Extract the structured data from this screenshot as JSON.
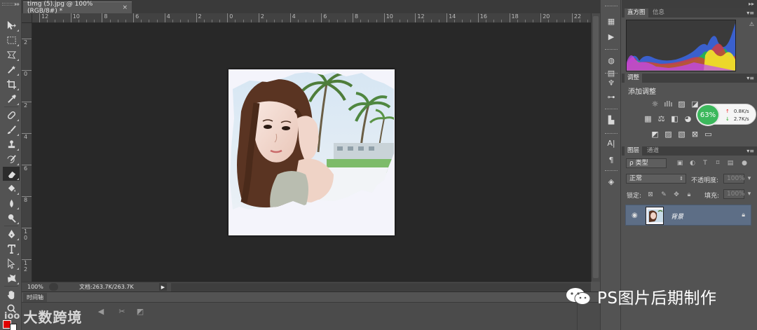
{
  "document": {
    "tab_title": "timg (5).jpg @ 100%(RGB/8#) *",
    "tab_close": "×",
    "zoom": "100%",
    "doc_info": "文档:263.7K/263.7K",
    "horizontal_ruler_marks": [
      "12",
      "10",
      "8",
      "6",
      "4",
      "2",
      "0",
      "2",
      "4",
      "6",
      "8",
      "10",
      "12",
      "14",
      "16",
      "18",
      "20",
      "22"
    ],
    "vertical_ruler_marks": [
      "2",
      "0",
      "2",
      "4",
      "6",
      "8",
      "1 0",
      "1 2"
    ]
  },
  "timeline": {
    "tab_label": "时间轴"
  },
  "panels": {
    "histogram_tabs": [
      "直方图",
      "信息"
    ],
    "adjustments_tab": "调整",
    "adjustments_title": "添加调整",
    "layers_tabs": [
      "图层",
      "通道"
    ],
    "filter_kind": "ρ 类型",
    "blend_mode": "正常",
    "opacity_label": "不透明度:",
    "opacity_value": "100%",
    "lock_label": "锁定:",
    "fill_label": "填充:",
    "fill_value": "100%",
    "layer_name": "背景"
  },
  "network_widget": {
    "percent": "63%",
    "upload": "0.8K/s",
    "download": "2.7K/s",
    "upload_color": "#e22222",
    "download_color": "#22aa22",
    "ring_color": "#3cb85c"
  },
  "watermarks": {
    "right_text": "PS图片后期制作",
    "left_text": "大数跨境",
    "left_logo_text": "ioo"
  },
  "colors": {
    "foreground": "#e00000",
    "background": "#ffffff",
    "canvas": "#282828",
    "panel": "#535353",
    "layer_selected": "#5d6e86"
  }
}
